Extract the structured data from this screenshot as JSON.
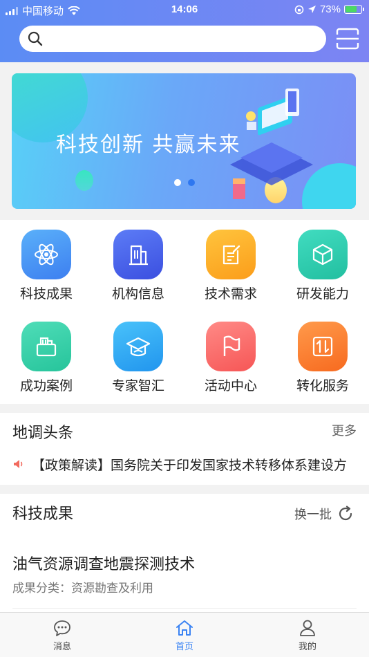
{
  "status_bar": {
    "carrier": "中国移动",
    "time": "14:06",
    "battery": "73%",
    "battery_level": 0.73
  },
  "search": {
    "placeholder": ""
  },
  "banner": {
    "slogan": "科技创新  共赢未来",
    "dots": 2,
    "active_dot": 0
  },
  "grid": [
    {
      "label": "科技成果",
      "icon": "atom-icon",
      "color": "#4f9cf5"
    },
    {
      "label": "机构信息",
      "icon": "building-icon",
      "color": "#4b6cf0"
    },
    {
      "label": "技术需求",
      "icon": "edit-document-icon",
      "color": "#fdb12c"
    },
    {
      "label": "研发能力",
      "icon": "cube-icon",
      "color": "#2fcfb0"
    },
    {
      "label": "成功案例",
      "icon": "folder-icon",
      "color": "#36cfa8"
    },
    {
      "label": "专家智汇",
      "icon": "graduation-cap-icon",
      "color": "#34aef4"
    },
    {
      "label": "活动中心",
      "icon": "flag-icon",
      "color": "#fb6a6a"
    },
    {
      "label": "转化服务",
      "icon": "transfer-icon",
      "color": "#fd7d36"
    }
  ],
  "headlines": {
    "title": "地调头条",
    "more": "更多",
    "news": "【政策解读】国务院关于印发国家技术转移体系建设方"
  },
  "achievements": {
    "title": "科技成果",
    "refresh_label": "换一批",
    "item_title": "油气资源调查地震探测技术",
    "item_meta": "成果分类：资源勘查及利用"
  },
  "tabbar": [
    {
      "label": "消息",
      "icon": "message-icon",
      "active": false
    },
    {
      "label": "首页",
      "icon": "home-icon",
      "active": true
    },
    {
      "label": "我的",
      "icon": "user-icon",
      "active": false
    }
  ],
  "colors": {
    "accent": "#3a83f3",
    "header_start": "#5b8cf4",
    "header_end": "#7d84f3"
  }
}
